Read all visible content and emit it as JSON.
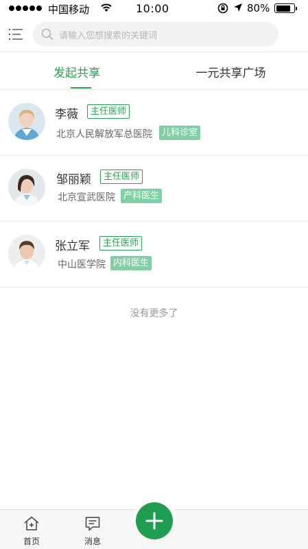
{
  "status_bar": {
    "carrier": "中国移动",
    "time": "10:00",
    "battery": "80%"
  },
  "search": {
    "placeholder": "请输入您想搜索的关键词"
  },
  "tabs": [
    {
      "label": "发起共享",
      "active": true
    },
    {
      "label": "一元共享广场",
      "active": false
    }
  ],
  "doctors": [
    {
      "name": "李薇",
      "title": "主任医师",
      "hospital": "北京人民解放军总医院",
      "department": "儿科诊室"
    },
    {
      "name": "邹丽颖",
      "title": "主任医师",
      "hospital": "北京宣武医院",
      "department": "产科医生"
    },
    {
      "name": "张立军",
      "title": "主任医师",
      "hospital": "中山医学院",
      "department": "内科医生"
    }
  ],
  "list_footer": "没有更多了",
  "bottom_nav": {
    "home_label": "首页",
    "messages_label": "消息"
  },
  "colors": {
    "accent": "#21a44e",
    "department_badge": "#7fd0a5",
    "fab": "#1f9e52"
  },
  "icons": [
    "menu-icon",
    "search-icon",
    "home-icon",
    "message-icon",
    "plus-icon",
    "wifi-icon",
    "location-arrow-icon",
    "rotation-lock-icon",
    "battery-icon"
  ]
}
